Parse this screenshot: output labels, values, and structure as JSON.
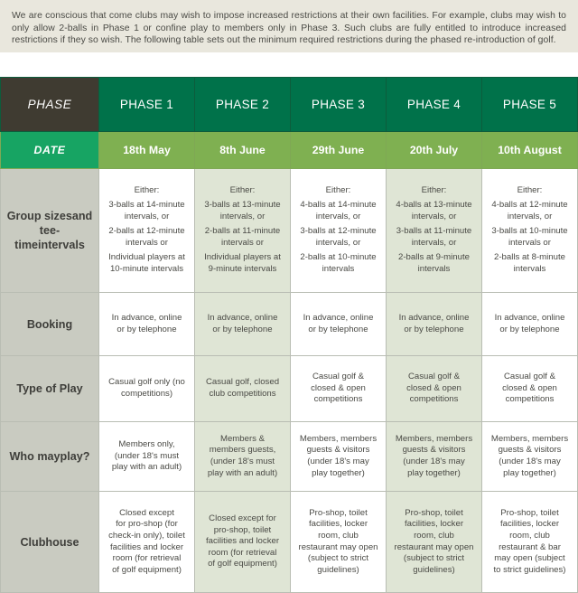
{
  "intro": {
    "paragraph": "We are conscious that come clubs may wish to impose increased restrictions at their own facilities. For example, clubs may wish to only allow 2-balls in Phase 1 or confine play to members only in Phase 3. Such clubs are fully entitled to introduce increased restrictions if they so wish. The following table sets out the minimum required restrictions during the phased re-introduction of golf."
  },
  "colors": {
    "intro_background": "#e9e7dd",
    "header_corner": "#3f3b31",
    "header_phase": "#00724a",
    "date_corner": "#17a463",
    "date_cell": "#7fb051",
    "row_label": "#c9cbc1",
    "cell_odd": "#ffffff",
    "cell_even": "#dfe5d5",
    "border": "#b9bdb3"
  },
  "table": {
    "header": {
      "corner_label": "PHASE",
      "phases": [
        "PHASE 1",
        "PHASE 2",
        "PHASE 3",
        "PHASE 4",
        "PHASE 5"
      ]
    },
    "date_row": {
      "label": "DATE",
      "dates": [
        "18th May",
        "8th June",
        "29th June",
        "20th July",
        "10th August"
      ]
    },
    "rows": [
      {
        "label": "Group sizes and tee-time intervals",
        "label_lines": [
          "Group sizes",
          "and tee-time",
          "intervals"
        ],
        "cells": [
          {
            "either": "Either:",
            "options": [
              [
                "3-balls at 14-minute",
                "intervals, or"
              ],
              [
                "2-balls at 12-minute",
                "intervals or"
              ],
              [
                "Individual players at",
                "10-minute intervals"
              ]
            ]
          },
          {
            "either": "Either:",
            "options": [
              [
                "3-balls at 13-minute",
                "intervals, or"
              ],
              [
                "2-balls at 11-minute",
                "intervals or"
              ],
              [
                "Individual players at",
                "9-minute intervals"
              ]
            ]
          },
          {
            "either": "Either:",
            "options": [
              [
                "4-balls at 14-minute",
                "intervals, or"
              ],
              [
                "3-balls at 12-minute",
                "intervals, or"
              ],
              [
                "2-balls at 10-minute",
                "intervals"
              ]
            ]
          },
          {
            "either": "Either:",
            "options": [
              [
                "4-balls at 13-minute",
                "intervals, or"
              ],
              [
                "3-balls at 11-minute",
                "intervals, or"
              ],
              [
                "2-balls at 9-minute",
                "intervals"
              ]
            ]
          },
          {
            "either": "Either:",
            "options": [
              [
                "4-balls at 12-minute",
                "intervals, or"
              ],
              [
                "3-balls at 10-minute",
                "intervals or"
              ],
              [
                "2-balls at 8-minute",
                "intervals"
              ]
            ]
          }
        ]
      },
      {
        "label": "Booking",
        "label_lines": [
          "Booking"
        ],
        "cells": [
          {
            "lines": [
              "In advance, online",
              "or by telephone"
            ]
          },
          {
            "lines": [
              "In advance, online",
              "or by telephone"
            ]
          },
          {
            "lines": [
              "In advance, online",
              "or by telephone"
            ]
          },
          {
            "lines": [
              "In advance, online",
              "or by telephone"
            ]
          },
          {
            "lines": [
              "In advance, online",
              "or by telephone"
            ]
          }
        ]
      },
      {
        "label": "Type of Play",
        "label_lines": [
          "Type of Play"
        ],
        "cells": [
          {
            "lines": [
              "Casual golf only (no",
              "competitions)"
            ]
          },
          {
            "lines": [
              "Casual golf, closed",
              "club competitions"
            ]
          },
          {
            "lines": [
              "Casual golf &",
              "closed & open",
              "competitions"
            ]
          },
          {
            "lines": [
              "Casual golf &",
              "closed & open",
              "competitions"
            ]
          },
          {
            "lines": [
              "Casual golf &",
              "closed & open",
              "competitions"
            ]
          }
        ]
      },
      {
        "label": "Who may play?",
        "label_lines": [
          "Who may",
          "play?"
        ],
        "cells": [
          {
            "lines": [
              "Members only,",
              "(under 18's must",
              "play with an adult)"
            ]
          },
          {
            "lines": [
              "Members &",
              "members guests,",
              "(under 18's must",
              "play with an adult)"
            ]
          },
          {
            "lines": [
              "Members, members",
              "guests & visitors",
              "(under 18's may",
              "play together)"
            ]
          },
          {
            "lines": [
              "Members, members",
              "guests & visitors",
              "(under 18's may",
              "play together)"
            ]
          },
          {
            "lines": [
              "Members, members",
              "guests & visitors",
              "(under 18's may",
              "play together)"
            ]
          }
        ]
      },
      {
        "label": "Clubhouse",
        "label_lines": [
          "Clubhouse"
        ],
        "cells": [
          {
            "lines": [
              "Closed except",
              "for pro-shop (for",
              "check-in only), toilet",
              "facilities and locker",
              "room (for retrieval",
              "of golf equipment)"
            ]
          },
          {
            "lines": [
              "Closed except for",
              "pro-shop, toilet",
              "facilities and locker",
              "room (for retrieval",
              "of golf equipment)"
            ]
          },
          {
            "lines": [
              "Pro-shop, toilet",
              "facilities, locker",
              "room, club",
              "restaurant may open",
              "(subject to strict",
              "guidelines)"
            ]
          },
          {
            "lines": [
              "Pro-shop, toilet",
              "facilities, locker",
              "room, club",
              "restaurant may open",
              "(subject to strict",
              "guidelines)"
            ]
          },
          {
            "lines": [
              "Pro-shop, toilet",
              "facilities, locker",
              "room, club",
              "restaurant & bar",
              "may open (subject",
              "to strict guidelines)"
            ]
          }
        ]
      }
    ]
  }
}
